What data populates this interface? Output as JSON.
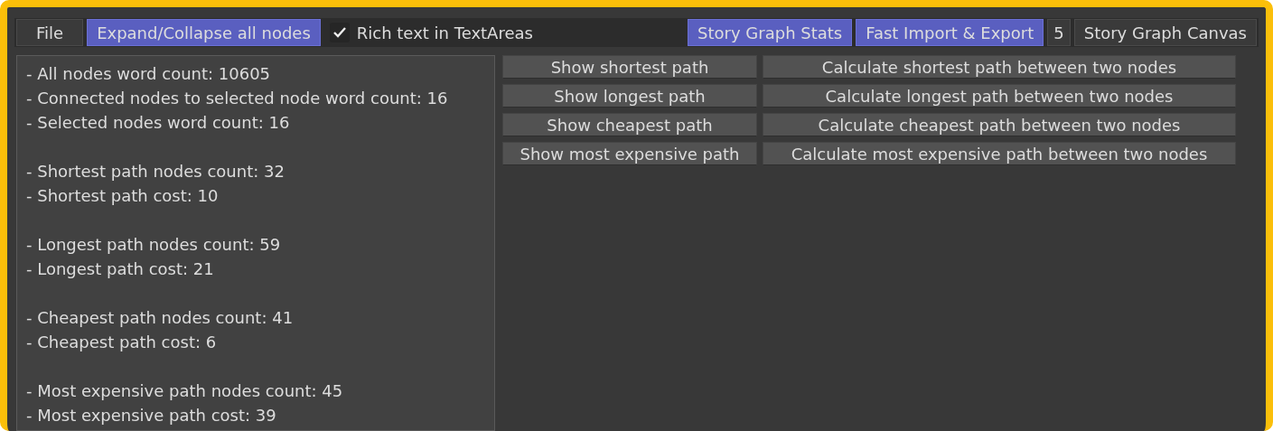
{
  "toolbar": [
    {
      "kind": "button",
      "label": "File",
      "active": false
    },
    {
      "kind": "button",
      "label": "Expand/Collapse all nodes",
      "active": true
    },
    {
      "kind": "checkbox",
      "label": "Rich text in TextAreas",
      "checked": true
    },
    {
      "kind": "spacer"
    },
    {
      "kind": "button",
      "label": "Story Graph Stats",
      "active": true
    },
    {
      "kind": "button",
      "label": "Fast Import & Export",
      "active": true
    },
    {
      "kind": "label",
      "label": "5"
    },
    {
      "kind": "button",
      "label": "Story Graph Canvas",
      "active": false
    }
  ],
  "stats": [
    [
      "- All nodes word count: 10605",
      "- Connected nodes to selected node word count: 16",
      "- Selected nodes word count: 16"
    ],
    [
      "- Shortest path nodes count: 32",
      "- Shortest path cost: 10"
    ],
    [
      "- Longest path nodes count: 59",
      "- Longest path cost: 21"
    ],
    [
      "- Cheapest path nodes count: 41",
      "- Cheapest path cost: 6"
    ],
    [
      "- Most expensive path nodes count: 45",
      "- Most expensive path cost: 39"
    ]
  ],
  "path_buttons": [
    [
      "Show shortest path",
      "Calculate shortest path between two nodes"
    ],
    [
      "Show longest path",
      "Calculate longest path between two nodes"
    ],
    [
      "Show cheapest path",
      "Calculate cheapest path between two nodes"
    ],
    [
      "Show most expensive path",
      "Calculate most expensive path between two nodes"
    ]
  ]
}
